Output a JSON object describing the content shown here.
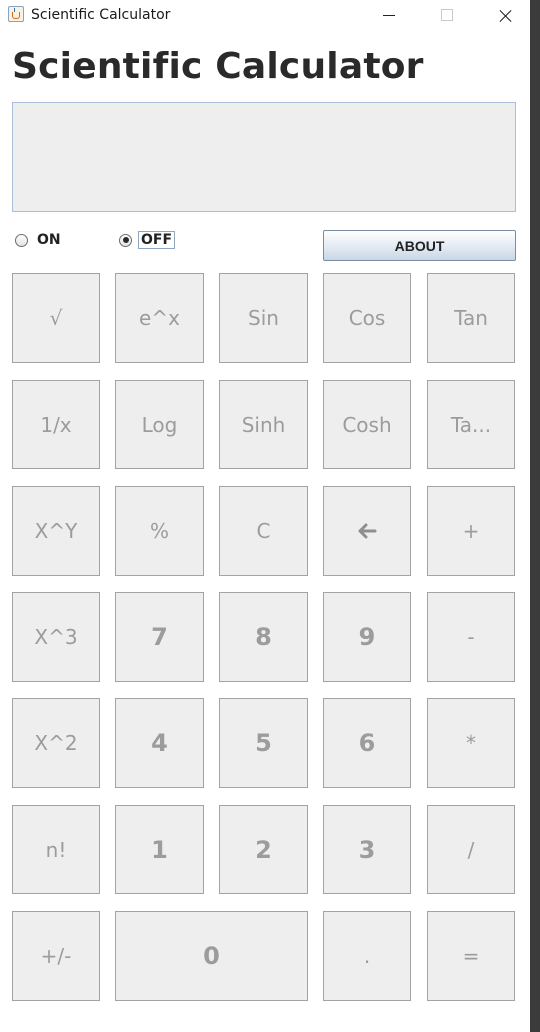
{
  "window": {
    "title": "Scientific Calculator"
  },
  "app": {
    "heading": "Scientific Calculator"
  },
  "display": {
    "value": ""
  },
  "power": {
    "on_label": "ON",
    "off_label": "OFF",
    "selected": "OFF"
  },
  "about_button": {
    "label": "ABOUT"
  },
  "keypad": {
    "row1": [
      "√",
      "e^x",
      "Sin",
      "Cos",
      "Tan"
    ],
    "row2": [
      "1/x",
      "Log",
      "Sinh",
      "Cosh",
      "Ta..."
    ],
    "row3": [
      "X^Y",
      "%",
      "C",
      "",
      "+"
    ],
    "row4": [
      "X^3",
      "7",
      "8",
      "9",
      "-"
    ],
    "row5": [
      "X^2",
      "4",
      "5",
      "6",
      "*"
    ],
    "row6": [
      "n!",
      "1",
      "2",
      "3",
      "/"
    ],
    "row7": [
      "+/-",
      "0",
      ".",
      "="
    ]
  },
  "icons": {
    "backspace_key": "arrow-left-icon",
    "window_icon": "java-cup-icon"
  },
  "colors": {
    "key_background": "#eeeeee",
    "key_text_disabled": "#9c9c9c",
    "display_border": "#a9c0d8"
  }
}
